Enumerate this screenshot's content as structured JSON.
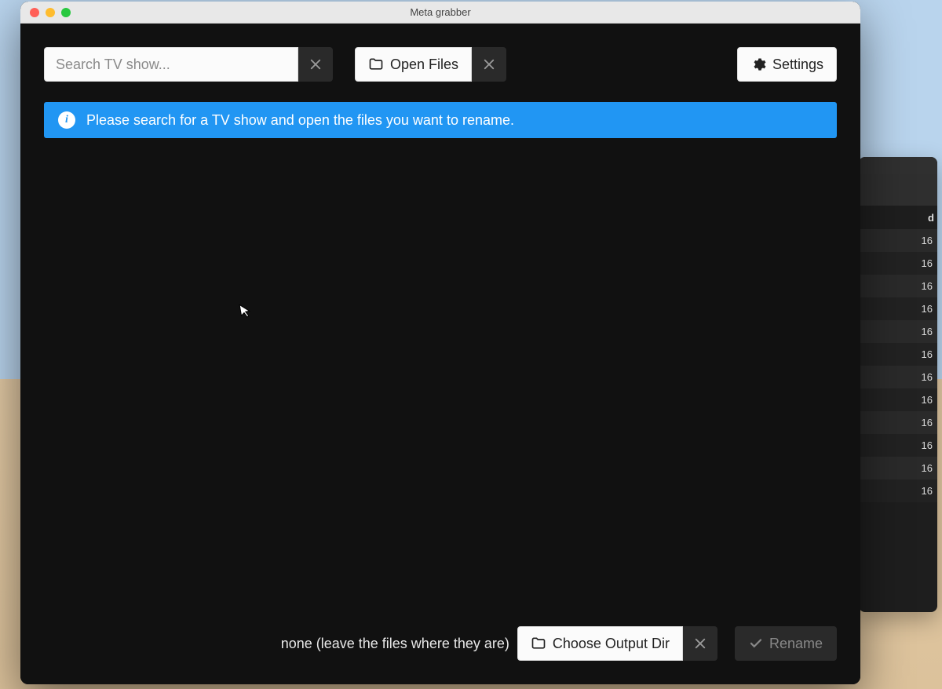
{
  "window": {
    "title": "Meta grabber"
  },
  "toolbar": {
    "search_placeholder": "Search TV show...",
    "open_files_label": "Open Files",
    "settings_label": "Settings"
  },
  "banner": {
    "message": "Please search for a TV show and open the files you want to rename."
  },
  "footer": {
    "output_dir_text": "none (leave the files where they are)",
    "choose_output_label": "Choose Output Dir",
    "rename_label": "Rename"
  },
  "background": {
    "header_fragment": "d",
    "row_values": [
      "16",
      "16",
      "16",
      "16",
      "16",
      "16",
      "16",
      "16",
      "16",
      "16",
      "16",
      "16"
    ]
  }
}
